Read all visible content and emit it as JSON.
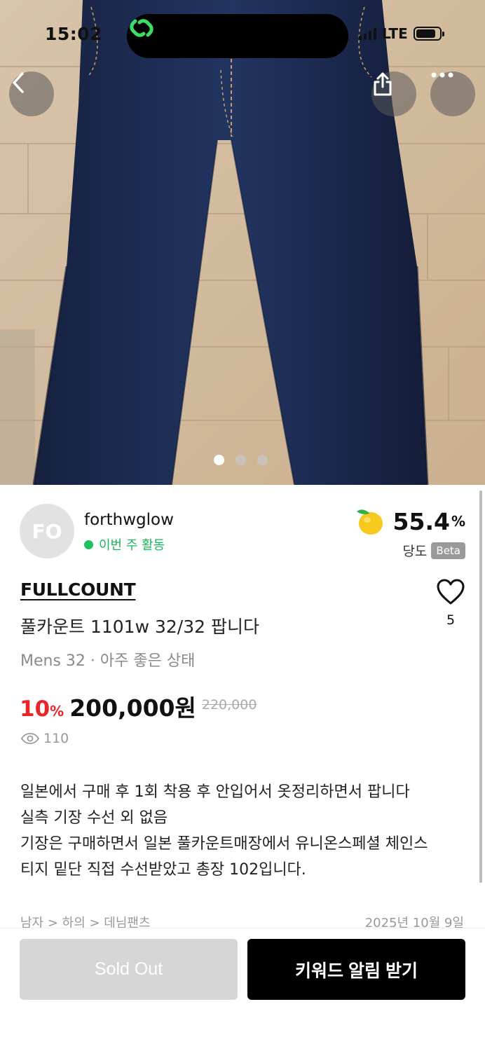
{
  "status_bar": {
    "time": "15:02",
    "network": "LTE",
    "battery_level": 0.85
  },
  "gallery": {
    "image_count": 3,
    "active_index": 0
  },
  "seller": {
    "avatar_initials": "FO",
    "name": "forthwglow",
    "activity": "이번 주 활동",
    "score_value": "55.4",
    "score_unit": "%",
    "score_label": "당도",
    "score_badge": "Beta"
  },
  "product": {
    "brand": "FULLCOUNT",
    "title": "풀카운트 1101w 32/32 팝니다",
    "sub_info": "Mens 32 · 아주 좋은 상태",
    "discount_value": "10",
    "discount_unit": "%",
    "price": "200,000원",
    "original_price": "220,000",
    "views": "110",
    "likes": "5",
    "description": [
      "일본에서 구매 후 1회 착용 후 안입어서 옷정리하면서 팝니다",
      "실측 기장 수선 외 없음",
      "기장은 구매하면서 일본 풀카운트매장에서 유니온스페셜 체인스",
      "티지 밑단 직접 수선받았고 총장 102입니다."
    ],
    "category": "남자 > 하의 > 데님팬츠",
    "date": "2025년 10월 9일"
  },
  "actions": {
    "sold_out_label": "Sold Out",
    "keyword_alert_label": "키워드 알림 받기"
  },
  "colors": {
    "discount_red": "#e8262a",
    "active_green": "#21c063",
    "denim": "#1c2a4f"
  },
  "icons": [
    "back-arrow-icon",
    "share-icon",
    "more-icon",
    "heart-icon",
    "eye-icon",
    "fruit-icon",
    "link-icon"
  ]
}
